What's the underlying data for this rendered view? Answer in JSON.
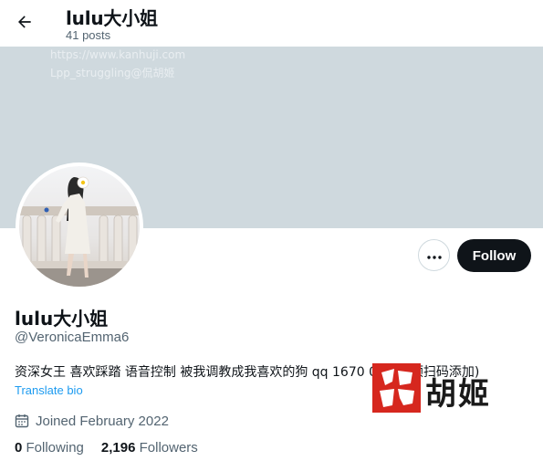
{
  "header": {
    "title": "lulu大小姐",
    "posts": "41 posts",
    "back_icon": "arrow-left-icon"
  },
  "banner": {
    "color": "#cfd9de",
    "watermark_line1": "https://www.kanhuji.com",
    "watermark_line2": "Lpp_struggling@侃胡姬"
  },
  "profile": {
    "display_name": "lulu大小姐",
    "handle": "@VeronicaEmma6",
    "bio": "资深女王 喜欢踩踏 语音控制 被我调教成我喜欢的狗 qq  1670     08（置顶扫码添加)",
    "translate_label": "Translate bio",
    "joined": "Joined February 2022",
    "following_count": "0",
    "following_label": "Following",
    "followers_count": "2,196",
    "followers_label": "Followers"
  },
  "actions": {
    "more_icon": "more-horizontal-icon",
    "follow_label": "Follow"
  },
  "watermark_stamp": {
    "text": "胡姬",
    "seal_color": "#d6271e"
  },
  "colors": {
    "text_primary": "#0f1419",
    "text_secondary": "#536471",
    "link": "#1d9bf0",
    "button_dark": "#0f1419"
  }
}
